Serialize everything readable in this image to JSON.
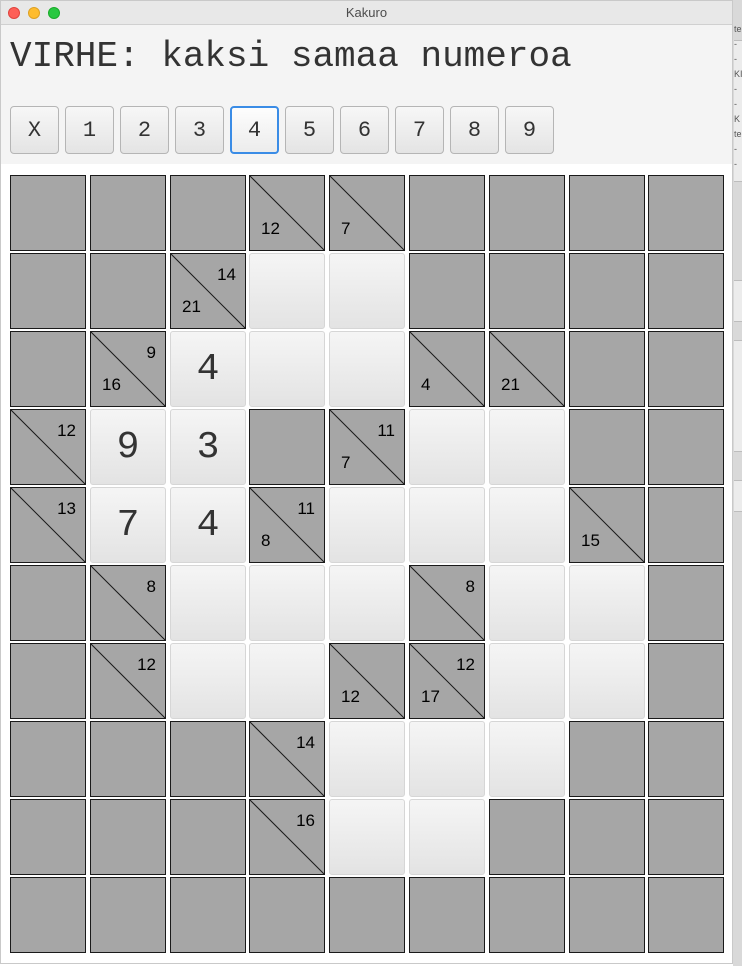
{
  "window": {
    "title": "Kakuro"
  },
  "status": {
    "message": "VIRHE: kaksi samaa numeroa"
  },
  "number_buttons": [
    {
      "label": "X"
    },
    {
      "label": "1"
    },
    {
      "label": "2"
    },
    {
      "label": "3"
    },
    {
      "label": "4"
    },
    {
      "label": "5"
    },
    {
      "label": "6"
    },
    {
      "label": "7"
    },
    {
      "label": "8"
    },
    {
      "label": "9"
    }
  ],
  "selected_number": "4",
  "grid": {
    "rows": 10,
    "cols": 9,
    "cells": [
      [
        {
          "type": "block"
        },
        {
          "type": "block"
        },
        {
          "type": "block"
        },
        {
          "type": "clue",
          "down": "12"
        },
        {
          "type": "clue",
          "down": "7"
        },
        {
          "type": "block"
        },
        {
          "type": "block"
        },
        {
          "type": "block"
        },
        {
          "type": "block"
        }
      ],
      [
        {
          "type": "block"
        },
        {
          "type": "block"
        },
        {
          "type": "clue",
          "down": "21",
          "right": "14"
        },
        {
          "type": "entry",
          "value": ""
        },
        {
          "type": "entry",
          "value": ""
        },
        {
          "type": "block"
        },
        {
          "type": "block"
        },
        {
          "type": "block"
        },
        {
          "type": "block"
        }
      ],
      [
        {
          "type": "block"
        },
        {
          "type": "clue",
          "down": "16",
          "right": "9"
        },
        {
          "type": "entry",
          "value": "4"
        },
        {
          "type": "entry",
          "value": ""
        },
        {
          "type": "entry",
          "value": ""
        },
        {
          "type": "clue",
          "down": "4"
        },
        {
          "type": "clue",
          "down": "21"
        },
        {
          "type": "block"
        },
        {
          "type": "block"
        }
      ],
      [
        {
          "type": "clue",
          "right": "12"
        },
        {
          "type": "entry",
          "value": "9"
        },
        {
          "type": "entry",
          "value": "3"
        },
        {
          "type": "block"
        },
        {
          "type": "clue",
          "down": "7",
          "right": "11"
        },
        {
          "type": "entry",
          "value": ""
        },
        {
          "type": "entry",
          "value": ""
        },
        {
          "type": "block"
        },
        {
          "type": "block"
        }
      ],
      [
        {
          "type": "clue",
          "right": "13"
        },
        {
          "type": "entry",
          "value": "7"
        },
        {
          "type": "entry",
          "value": "4"
        },
        {
          "type": "clue",
          "down": "8",
          "right": "11"
        },
        {
          "type": "entry",
          "value": ""
        },
        {
          "type": "entry",
          "value": ""
        },
        {
          "type": "entry",
          "value": ""
        },
        {
          "type": "clue",
          "down": "15"
        },
        {
          "type": "block"
        }
      ],
      [
        {
          "type": "block"
        },
        {
          "type": "clue",
          "right": "8"
        },
        {
          "type": "entry",
          "value": ""
        },
        {
          "type": "entry",
          "value": ""
        },
        {
          "type": "entry",
          "value": ""
        },
        {
          "type": "clue",
          "right": "8"
        },
        {
          "type": "entry",
          "value": ""
        },
        {
          "type": "entry",
          "value": ""
        },
        {
          "type": "block"
        }
      ],
      [
        {
          "type": "block"
        },
        {
          "type": "clue",
          "right": "12"
        },
        {
          "type": "entry",
          "value": ""
        },
        {
          "type": "entry",
          "value": ""
        },
        {
          "type": "clue",
          "down": "12"
        },
        {
          "type": "clue",
          "down": "17",
          "right": "12"
        },
        {
          "type": "entry",
          "value": ""
        },
        {
          "type": "entry",
          "value": ""
        },
        {
          "type": "block"
        }
      ],
      [
        {
          "type": "block"
        },
        {
          "type": "block"
        },
        {
          "type": "block"
        },
        {
          "type": "clue",
          "right": "14"
        },
        {
          "type": "entry",
          "value": ""
        },
        {
          "type": "entry",
          "value": ""
        },
        {
          "type": "entry",
          "value": ""
        },
        {
          "type": "block"
        },
        {
          "type": "block"
        }
      ],
      [
        {
          "type": "block"
        },
        {
          "type": "block"
        },
        {
          "type": "block"
        },
        {
          "type": "clue",
          "right": "16"
        },
        {
          "type": "entry",
          "value": ""
        },
        {
          "type": "entry",
          "value": ""
        },
        {
          "type": "block"
        },
        {
          "type": "block"
        },
        {
          "type": "block"
        }
      ],
      [
        {
          "type": "block"
        },
        {
          "type": "block"
        },
        {
          "type": "block"
        },
        {
          "type": "block"
        },
        {
          "type": "block"
        },
        {
          "type": "block"
        },
        {
          "type": "block"
        },
        {
          "type": "block"
        },
        {
          "type": "block"
        }
      ]
    ]
  },
  "background_window": {
    "edge_chars": [
      "te",
      "-",
      "-",
      "KI",
      "-",
      "-",
      "K",
      "te",
      "-",
      "-"
    ]
  }
}
